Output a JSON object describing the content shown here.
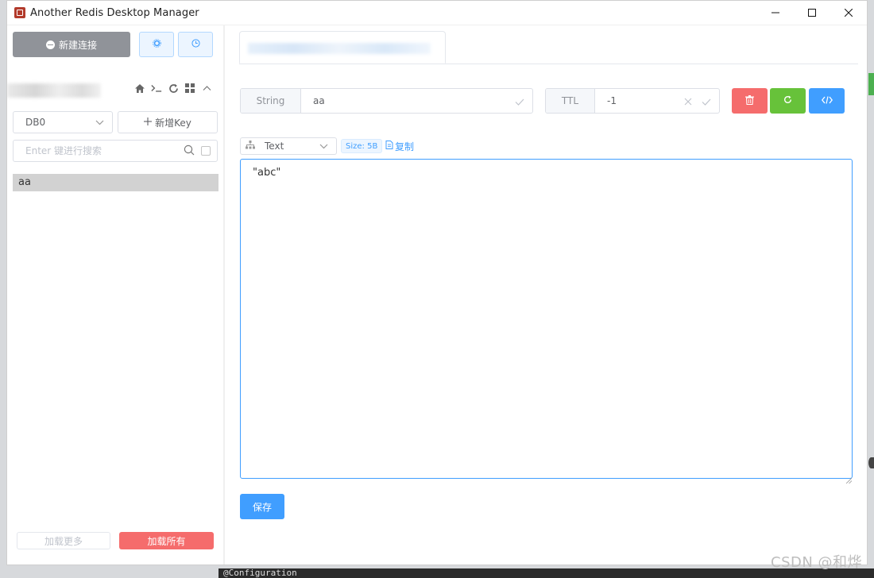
{
  "window": {
    "title": "Another Redis Desktop Manager"
  },
  "sidebar": {
    "new_connection_label": "新建连接",
    "db_select_value": "DB0",
    "add_key_label": "新增Key",
    "search_placeholder": "Enter 键进行搜索",
    "keys": [
      {
        "name": "aa"
      }
    ],
    "load_more_label": "加载更多",
    "load_all_label": "加载所有"
  },
  "key_detail": {
    "type_label": "String",
    "key_name": "aa",
    "ttl_label": "TTL",
    "ttl_value": "-1",
    "format_value": "Text",
    "size_tag": "Size: 5B",
    "copy_label": "复制",
    "value": "\"abc\"",
    "save_label": "保存"
  },
  "background": {
    "code_snippet": "@Configuration",
    "watermark": "CSDN @和烨"
  },
  "colors": {
    "primary": "#409eff",
    "danger": "#f56c6c",
    "success": "#67c23a",
    "info": "#909399"
  }
}
